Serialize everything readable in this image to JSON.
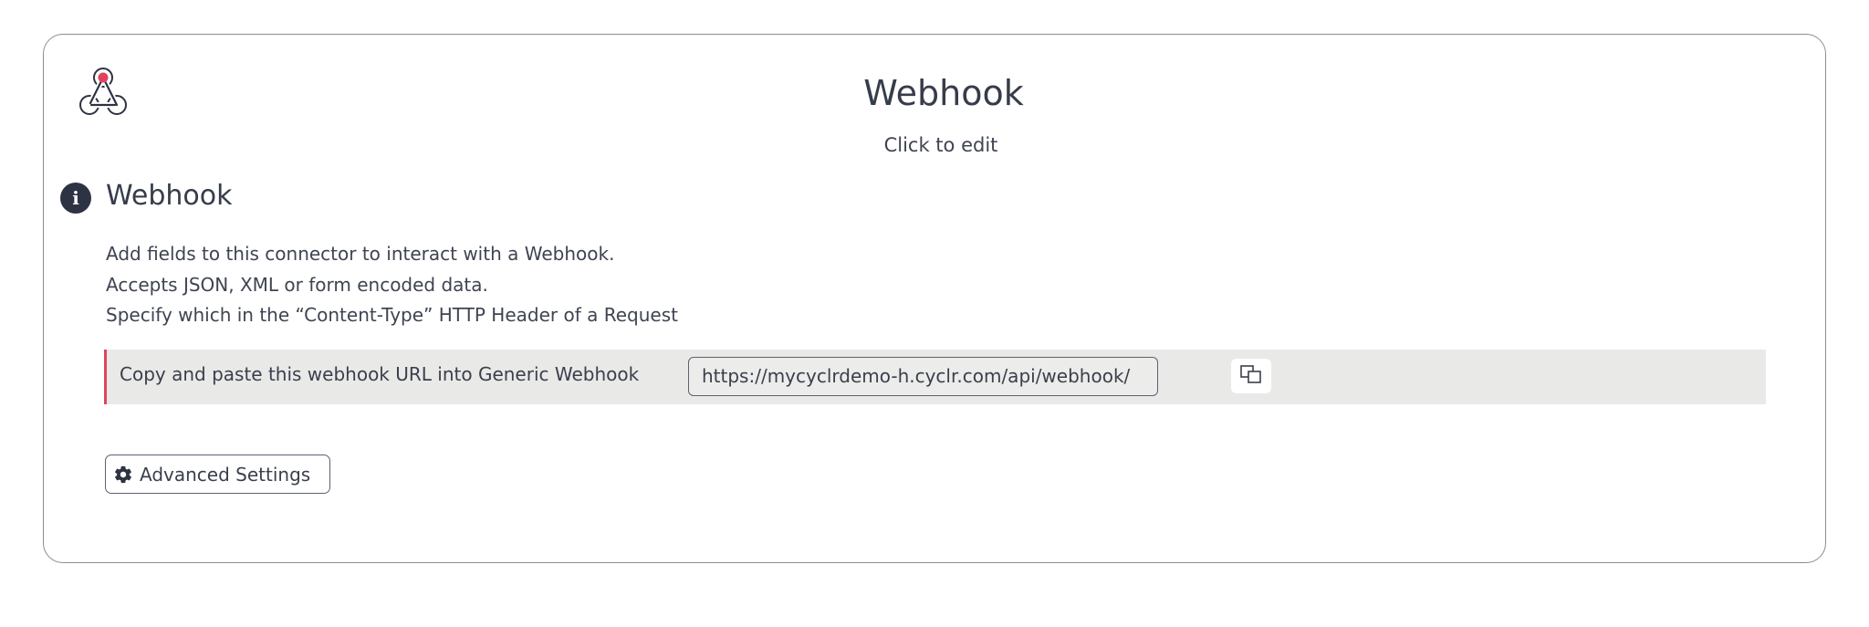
{
  "header": {
    "title": "Webhook",
    "subtitle": "Click to edit"
  },
  "section": {
    "title": "Webhook",
    "description": [
      "Add fields to this connector to interact with a Webhook.",
      "Accepts JSON, XML or form encoded data.",
      "Specify which in the “Content-Type” HTTP Header of a Request"
    ]
  },
  "webhook": {
    "label": "Copy and paste this webhook URL into Generic Webhook",
    "url": "https://mycyclrdemo-h.cyclr.com/api/webhook/"
  },
  "advanced": {
    "label": "Advanced Settings"
  },
  "icons": {
    "logo": "webhook-logo-icon",
    "info": "info-icon",
    "copy": "copy-icon",
    "settings": "gear-icon"
  },
  "colors": {
    "accent": "#e0435e",
    "dark": "#2d3343",
    "bar_background": "#e9e9e8"
  }
}
